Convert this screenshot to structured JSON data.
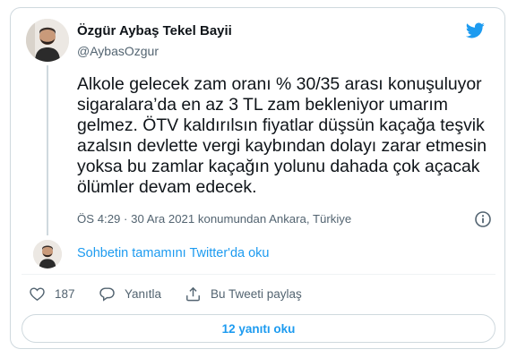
{
  "tweet": {
    "author_name": "Özgür Aybaş Tekel Bayii",
    "author_handle": "@AybasOzgur",
    "text": "Alkole gelecek zam oranı % 30/35 arası konuşuluyor\nsigaralara’da en az 3 TL zam bekleniyor umarım\ngelmez. ÖTV kaldırılsın fiyatlar düşsün kaçağa teşvik\nazalsın devlette vergi kaybından dolayı zarar etmesin\nyoksa bu zamlar kaçağın yolunu dahada çok açacak\nölümler devam edecek.",
    "timestamp": "ÖS 4:29 · 30 Ara 2021 konumundan Ankara, Türkiye"
  },
  "thread": {
    "read_label": "Sohbetin tamamını Twitter'da oku"
  },
  "actions": {
    "like_count": "187",
    "reply_label": "Yanıtla",
    "share_label": "Bu Tweeti paylaş"
  },
  "replies_button": {
    "label": "12 yanıtı oku"
  },
  "colors": {
    "accent": "#1d9bf0",
    "text": "#0f1419",
    "muted": "#536471",
    "border": "#cfd9de"
  },
  "icons": {
    "brand": "twitter-bird-icon",
    "info": "info-icon",
    "like": "heart-icon",
    "reply": "comment-icon",
    "share": "share-icon"
  }
}
